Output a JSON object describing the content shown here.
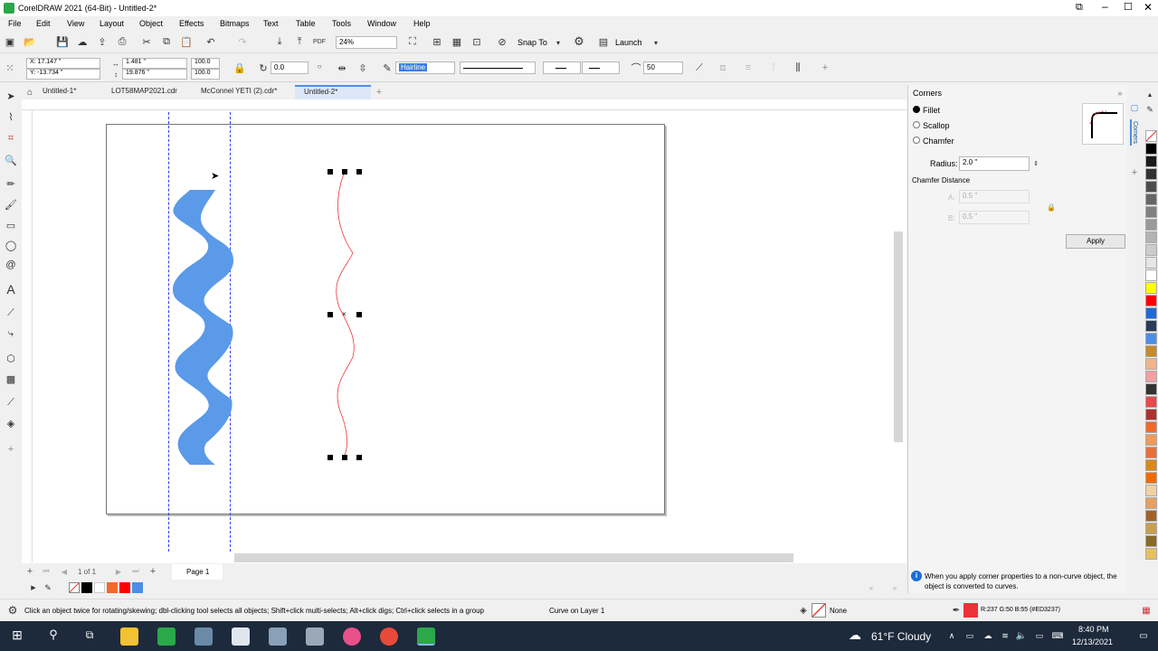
{
  "app": {
    "title": "CorelDRAW 2021 (64-Bit) - Untitled-2*"
  },
  "menu": [
    "File",
    "Edit",
    "View",
    "Layout",
    "Object",
    "Effects",
    "Bitmaps",
    "Text",
    "Table",
    "Tools",
    "Window",
    "Help"
  ],
  "toolbar": {
    "zoom": "24%",
    "snap": "Snap To",
    "launch": "Launch"
  },
  "propbar": {
    "x": "X: 17.147 \"",
    "y": "Y: -13.734 \"",
    "w": "1.481 \"",
    "h": "19.876 \"",
    "sx": "100.0",
    "sy": "100.0",
    "angle": "0.0",
    "outline_width": "Hairline",
    "smoothing": "50"
  },
  "tabs": [
    "Untitled-1*",
    "LOT58MAP2021.cdr",
    "McConnel YETI (2).cdr*",
    "Untitled-2*"
  ],
  "docker": {
    "title": "Corners",
    "options": [
      "Fillet",
      "Scallop",
      "Chamfer"
    ],
    "radius_label": "Radius:",
    "radius_value": "2.0 \"",
    "chamfer_label": "Chamfer Distance",
    "chamfer_a_prefix": "A:",
    "chamfer_a": "0.5 \"",
    "chamfer_b_prefix": "B:",
    "chamfer_b": "0.5 \"",
    "apply": "Apply",
    "tab_label": "Corners",
    "info": "When you apply corner properties to a non-curve object, the object is converted to curves."
  },
  "pagenav": {
    "count": "1 of 1",
    "page": "Page 1"
  },
  "status": {
    "hint": "Click an object twice for rotating/skewing; dbl-clicking tool selects all objects; Shift+click multi-selects; Alt+click digs; Ctrl+click selects in a group",
    "object": "Curve on Layer 1",
    "fill": "None",
    "outline": "R:237 G:50 B:55 (#ED3237)"
  },
  "taskbar": {
    "weather": "61°F  Cloudy",
    "time": "8:40 PM",
    "date": "12/13/2021"
  },
  "colors": {
    "accent": "#4b8ee8",
    "outline": "#ED3237",
    "wave": "#5a9ae8"
  },
  "palette": [
    "#000000",
    "#1a1a1a",
    "#333333",
    "#4d4d4d",
    "#666666",
    "#808080",
    "#999999",
    "#b3b3b3",
    "#cccccc",
    "#e6e6e6",
    "#ffffff",
    "#ffff00",
    "#ff0000",
    "#1e6ad6",
    "#2a3b5a",
    "#4b8ee8",
    "#c88a2a",
    "#f2b48a",
    "#f2a0a0",
    "#e84a4a",
    "#b03030",
    "#f26a2a",
    "#f29a5a",
    "#f2d0a0",
    "#d9891a",
    "#a0642a",
    "#c8a050",
    "#e8c060"
  ],
  "quick_colors": [
    "#ffffff",
    "#000000",
    "#ffffff",
    "#f26a2a",
    "#ff0000",
    "#4b8ee8"
  ]
}
